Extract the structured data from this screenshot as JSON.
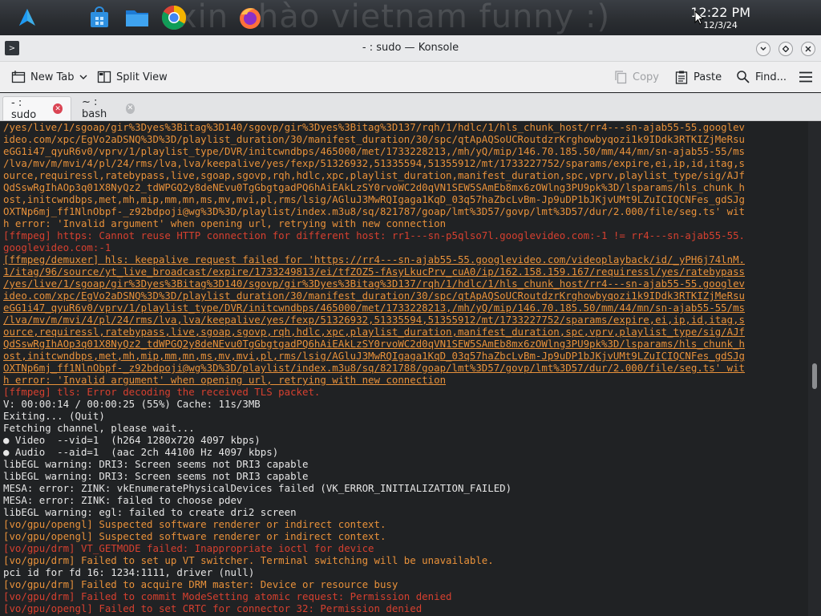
{
  "taskbar": {
    "wallpaper_text": "xin chào vietnam funny :)",
    "clock_time": "12:22 PM",
    "clock_date": "12/3/24",
    "apps": [
      "app-launcher-icon",
      "app-store-icon",
      "file-manager-icon",
      "chrome-icon",
      "firefox-icon"
    ]
  },
  "window": {
    "title": "- : sudo — Konsole"
  },
  "toolbar": {
    "new_tab": "New Tab",
    "split_view": "Split View",
    "copy": "Copy",
    "paste": "Paste",
    "find": "Find..."
  },
  "tabs": [
    {
      "label": "- : sudo",
      "active": true
    },
    {
      "label": "~ : bash",
      "active": false
    }
  ],
  "terminal_lines": [
    {
      "style": "orange",
      "text": "/yes/live/1/sgoap/gir%3Dyes%3Bitag%3D140/sgovp/gir%3Dyes%3Bitag%3D137/rqh/1/hdlc/1/hls_chunk_host/rr4---sn-ajab55-55.googlev"
    },
    {
      "style": "orange",
      "text": "ideo.com/xpc/EgVo2aDSNQ%3D%3D/playlist_duration/30/manifest_duration/30/spc/qtApAQSoUCRoutdzrKrghowbyqozi1k9IDdk3RTKIZjMeRsu"
    },
    {
      "style": "orange",
      "text": "eGG1i47_qyuR6v0/vprv/1/playlist_type/DVR/initcwndbps/465000/met/1733228213,/mh/yQ/mip/146.70.185.50/mm/44/mn/sn-ajab55-55/ms"
    },
    {
      "style": "orange",
      "text": "/lva/mv/m/mvi/4/pl/24/rms/lva,lva/keepalive/yes/fexp/51326932,51335594,51355912/mt/1733227752/sparams/expire,ei,ip,id,itag,s"
    },
    {
      "style": "orange",
      "text": "ource,requiressl,ratebypass,live,sgoap,sgovp,rqh,hdlc,xpc,playlist_duration,manifest_duration,spc,vprv,playlist_type/sig/AJf"
    },
    {
      "style": "orange",
      "text": "QdSswRgIhAOp3q01X8NyQz2_tdWPGQ2y8deNEvu0TgGbgtgadPQ6hAiEAkLzSY0rvoWC2d0qVN1SEW5SAmEb8mx6zOWlng3PU9pk%3D/lsparams/hls_chunk_h"
    },
    {
      "style": "orange",
      "text": "ost,initcwndbps,met,mh,mip,mm,mn,ms,mv,mvi,pl,rms/lsig/AGluJ3MwRQIgaga1KqD_03q57haZbcLvBm-Jp9uDP1bJKjvUMt9LZuICIQCNFes_gdSJg"
    },
    {
      "style": "orange",
      "text": "OXTNp6mj_ff1NlnObpf-_z92bdpoji@wg%3D%3D/playlist/index.m3u8/sq/821787/goap/lmt%3D57/govp/lmt%3D57/dur/2.000/file/seg.ts' wit"
    },
    {
      "style": "orange",
      "text": "h error: 'Invalid argument' when opening url, retrying with new connection"
    },
    {
      "style": "red",
      "text": "[ffmpeg] https: Cannot reuse HTTP connection for different host: rr1---sn-p5qlso7l.googlevideo.com:-1 != rr4---sn-ajab55-55."
    },
    {
      "style": "red",
      "text": "googlevideo.com:-1"
    },
    {
      "style": "orange",
      "text": "[ffmpeg/demuxer] hls: keepalive request failed for 'https://rr4---sn-ajab55-55.googlevideo.com/videoplayback/id/_yPH6j74lnM."
    },
    {
      "style": "orange",
      "text": "1/itag/96/source/yt_live_broadcast/expire/1733249813/ei/tfZOZ5-fAsyLkucPrv_cuA0/ip/162.158.159.167/requiressl/yes/ratebypass"
    },
    {
      "style": "orange",
      "text": "/yes/live/1/sgoap/gir%3Dyes%3Bitag%3D140/sgovp/gir%3Dyes%3Bitag%3D137/rqh/1/hdlc/1/hls_chunk_host/rr4---sn-ajab55-55.googlev"
    },
    {
      "style": "orange",
      "text": "ideo.com/xpc/EgVo2aDSNQ%3D%3D/playlist_duration/30/manifest_duration/30/spc/qtApAQSoUCRoutdzrKrghowbyqozi1k9IDdk3RTKIZjMeRsu"
    },
    {
      "style": "orange",
      "text": "eGG1i47_qyuR6v0/vprv/1/playlist_type/DVR/initcwndbps/465000/met/1733228213,/mh/yQ/mip/146.70.185.50/mm/44/mn/sn-ajab55-55/ms"
    },
    {
      "style": "orange",
      "text": "/lva/mv/m/mvi/4/pl/24/rms/lva,lva/keepalive/yes/fexp/51326932,51335594,51355912/mt/1733227752/sparams/expire,ei,ip,id,itag,s"
    },
    {
      "style": "orange",
      "text": "ource,requiressl,ratebypass,live,sgoap,sgovp,rqh,hdlc,xpc,playlist_duration,manifest_duration,spc,vprv,playlist_type/sig/AJf"
    },
    {
      "style": "orange",
      "text": "QdSswRgIhAOp3q01X8NyQz2_tdWPGQ2y8deNEvu0TgGbgtgadPQ6hAiEAkLzSY0rvoWC2d0qVN1SEW5SAmEb8mx6zOWlng3PU9pk%3D/lsparams/hls_chunk_h"
    },
    {
      "style": "orange",
      "text": "ost,initcwndbps,met,mh,mip,mm,mn,ms,mv,mvi,pl,rms/lsig/AGluJ3MwRQIgaga1KqD_03q57haZbcLvBm-Jp9uDP1bJKjvUMt9LZuICIQCNFes_gdSJg"
    },
    {
      "style": "orange",
      "text": "OXTNp6mj_ff1NlnObpf-_z92bdpoji@wg%3D%3D/playlist/index.m3u8/sq/821788/goap/lmt%3D57/govp/lmt%3D57/dur/2.000/file/seg.ts' wit"
    },
    {
      "style": "orange",
      "text": "h error: 'Invalid argument' when opening url, retrying with new connection"
    },
    {
      "style": "red",
      "text": "[ffmpeg] tls: Error decoding the received TLS packet."
    },
    {
      "style": "white",
      "text": "V: 00:00:14 / 00:00:25 (55%) Cache: 11s/3MB"
    },
    {
      "style": "white",
      "text": "Exiting... (Quit)"
    },
    {
      "style": "white",
      "text": "Fetching channel, please wait..."
    },
    {
      "style": "white",
      "text": "● Video  --vid=1  (h264 1280x720 4097 kbps)"
    },
    {
      "style": "white",
      "text": "● Audio  --aid=1  (aac 2ch 44100 Hz 4097 kbps)"
    },
    {
      "style": "white",
      "text": "libEGL warning: DRI3: Screen seems not DRI3 capable"
    },
    {
      "style": "white",
      "text": "libEGL warning: DRI3: Screen seems not DRI3 capable"
    },
    {
      "style": "white",
      "text": "MESA: error: ZINK: vkEnumeratePhysicalDevices failed (VK_ERROR_INITIALIZATION_FAILED)"
    },
    {
      "style": "white",
      "text": "MESA: error: ZINK: failed to choose pdev"
    },
    {
      "style": "white",
      "text": "libEGL warning: egl: failed to create dri2 screen"
    },
    {
      "style": "orange",
      "text": "[vo/gpu/opengl] Suspected software renderer or indirect context."
    },
    {
      "style": "orange",
      "text": "[vo/gpu/opengl] Suspected software renderer or indirect context."
    },
    {
      "style": "red",
      "text": "[vo/gpu/drm] VT_GETMODE failed: Inappropriate ioctl for device"
    },
    {
      "style": "orange",
      "text": "[vo/gpu/drm] Failed to set up VT switcher. Terminal switching will be unavailable."
    },
    {
      "style": "white",
      "text": "pci id for fd 16: 1234:1111, driver (null)"
    },
    {
      "style": "orange",
      "text": "[vo/gpu/drm] Failed to acquire DRM master: Device or resource busy"
    },
    {
      "style": "red",
      "text": "[vo/gpu/drm] Failed to commit ModeSetting atomic request: Permission denied"
    },
    {
      "style": "red",
      "text": "[vo/gpu/opengl] Failed to set CRTC for connector 32: Permission denied"
    }
  ]
}
